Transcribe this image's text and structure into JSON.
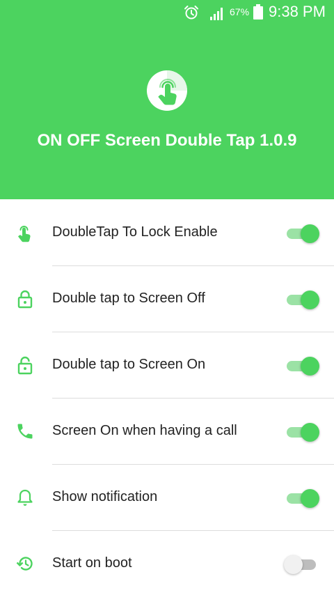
{
  "status_bar": {
    "battery_percent": "67%",
    "time": "9:38 PM",
    "icons": [
      "alarm-icon",
      "signal-icon",
      "battery-icon"
    ]
  },
  "header": {
    "title": "ON OFF Screen Double Tap 1.0.9",
    "logo_icon": "double-tap-hand-icon",
    "background_color": "#4cd35f"
  },
  "settings": [
    {
      "label": "DoubleTap To Lock Enable",
      "icon": "tap-hand-icon",
      "enabled": true
    },
    {
      "label": "Double tap to Screen Off",
      "icon": "lock-icon",
      "enabled": true
    },
    {
      "label": "Double tap to Screen On",
      "icon": "unlock-icon",
      "enabled": true
    },
    {
      "label": "Screen On when having a call",
      "icon": "phone-icon",
      "enabled": true
    },
    {
      "label": "Show notification",
      "icon": "bell-icon",
      "enabled": true
    },
    {
      "label": "Start on boot",
      "icon": "restore-icon",
      "enabled": false
    }
  ],
  "colors": {
    "accent": "#4cd35f",
    "toggle_track_on": "#9be2a5",
    "toggle_off": "#bdbdbd"
  }
}
